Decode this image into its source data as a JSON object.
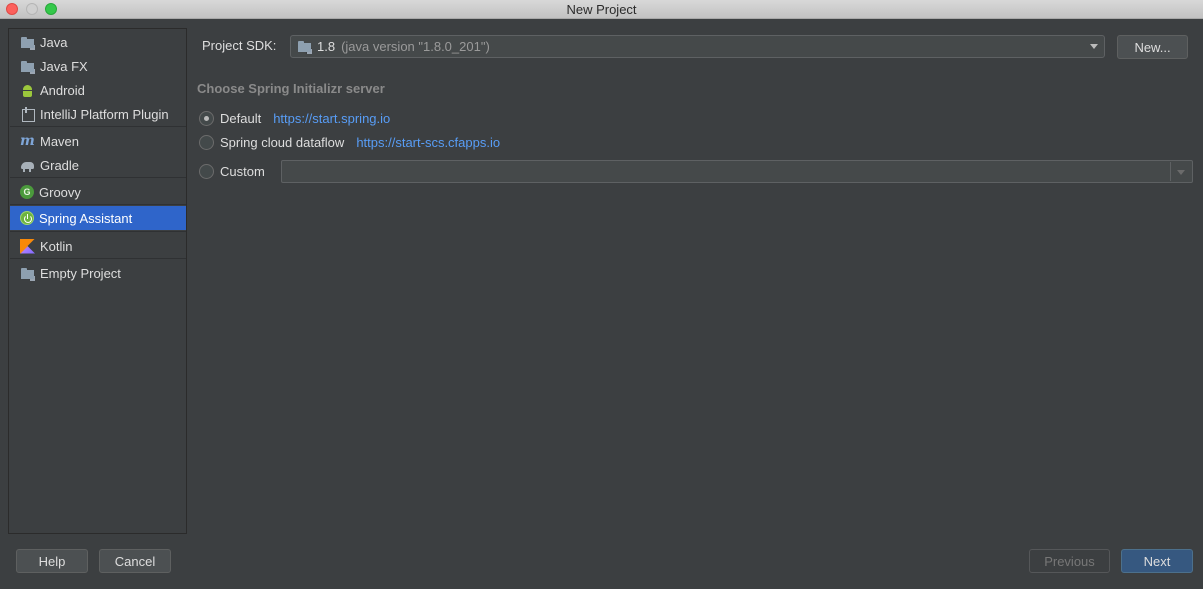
{
  "window": {
    "title": "New Project"
  },
  "sidebar": {
    "items": [
      {
        "label": "Java",
        "icon": "folder-icon"
      },
      {
        "label": "Java FX",
        "icon": "folder-icon"
      },
      {
        "label": "Android",
        "icon": "android-icon"
      },
      {
        "label": "IntelliJ Platform Plugin",
        "icon": "plugin-icon"
      },
      {
        "label": "Maven",
        "icon": "maven-icon"
      },
      {
        "label": "Gradle",
        "icon": "gradle-icon"
      },
      {
        "label": "Groovy",
        "icon": "groovy-icon"
      },
      {
        "label": "Spring Assistant",
        "icon": "spring-icon",
        "selected": true
      },
      {
        "label": "Kotlin",
        "icon": "kotlin-icon"
      },
      {
        "label": "Empty Project",
        "icon": "folder-icon"
      }
    ]
  },
  "sdk": {
    "label": "Project SDK:",
    "value": "1.8",
    "detail": "(java version \"1.8.0_201\")",
    "new_button": "New..."
  },
  "server": {
    "section_title": "Choose Spring Initializr server",
    "options": [
      {
        "label": "Default",
        "url": "https://start.spring.io",
        "checked": true
      },
      {
        "label": "Spring cloud dataflow",
        "url": "https://start-scs.cfapps.io",
        "checked": false
      },
      {
        "label": "Custom",
        "url": "",
        "checked": false
      }
    ],
    "custom_value": ""
  },
  "footer": {
    "help": "Help",
    "cancel": "Cancel",
    "previous": "Previous",
    "next": "Next"
  },
  "colors": {
    "background": "#3c3f41",
    "selection": "#2f65ca",
    "link": "#589df6",
    "default_button": "#365880"
  }
}
